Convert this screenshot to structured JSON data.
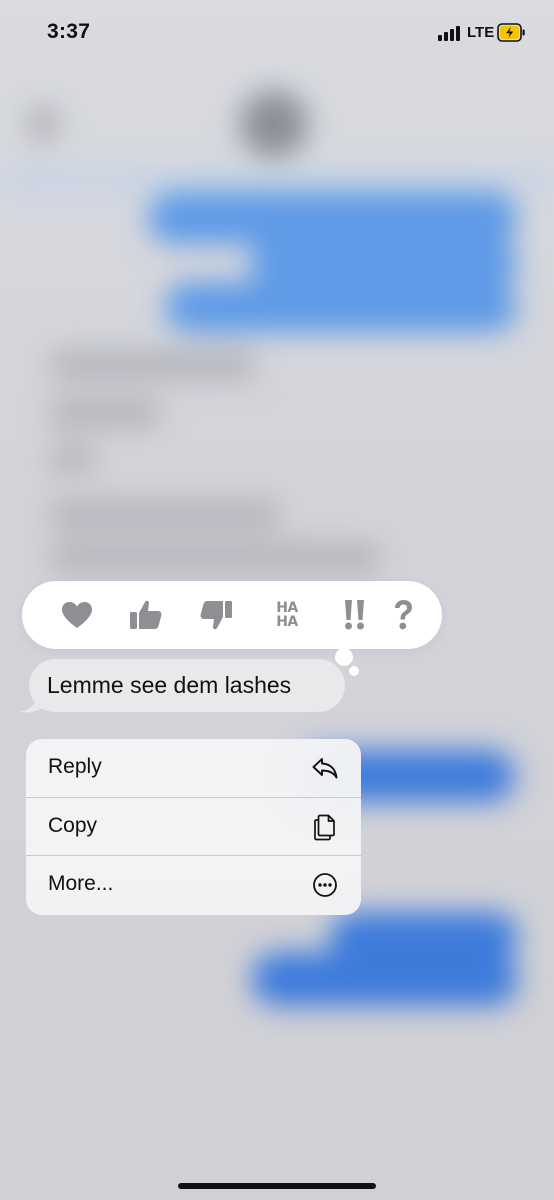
{
  "status_bar": {
    "time": "3:37",
    "network": "LTE",
    "battery_charging_color": "#f5c400",
    "signal_icon": "cellular-signal-icon",
    "battery_icon": "battery-charging-icon"
  },
  "tapback": {
    "reactions": [
      {
        "name": "heart",
        "icon": "heart-icon"
      },
      {
        "name": "thumbs-up",
        "icon": "thumbs-up-icon"
      },
      {
        "name": "thumbs-down",
        "icon": "thumbs-down-icon"
      },
      {
        "name": "haha",
        "icon": "haha-icon",
        "line1": "HA",
        "line2": "HA"
      },
      {
        "name": "emphasize",
        "icon": "double-exclamation-icon",
        "text": "!!"
      },
      {
        "name": "question",
        "icon": "question-mark-icon",
        "text": "?"
      }
    ],
    "icon_color": "#8e8e93"
  },
  "message": {
    "text": "Lemme see dem lashes",
    "bubble_color": "#e9e9eb"
  },
  "context_menu": {
    "items": [
      {
        "label": "Reply",
        "icon": "reply-arrow-icon"
      },
      {
        "label": "Copy",
        "icon": "copy-documents-icon"
      },
      {
        "label": "More...",
        "icon": "more-ellipsis-circle-icon"
      }
    ]
  },
  "colors": {
    "imessage_blue": "#3d7bdb",
    "background": "#d1d1d6"
  }
}
